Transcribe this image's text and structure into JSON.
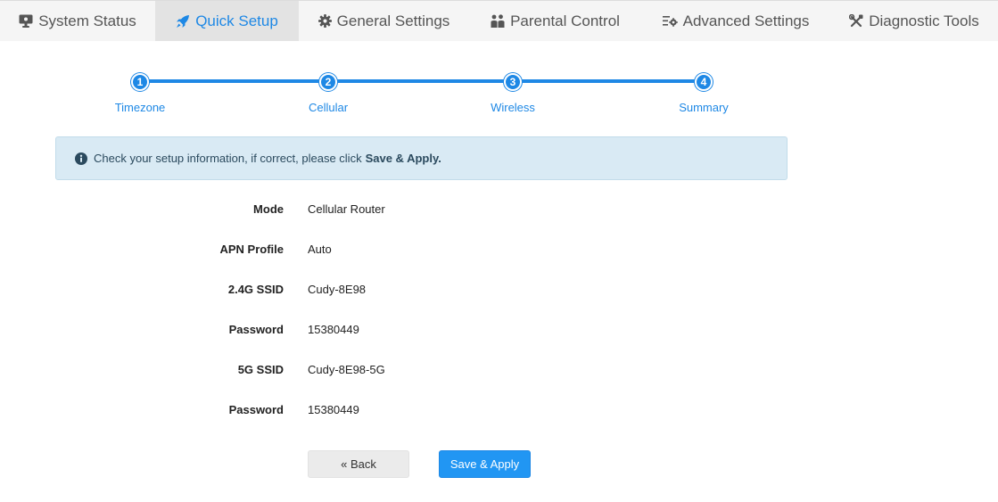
{
  "nav": {
    "tabs": [
      {
        "label": "System Status",
        "icon": "monitor-icon",
        "active": false
      },
      {
        "label": "Quick Setup",
        "icon": "rocket-icon",
        "active": true
      },
      {
        "label": "General Settings",
        "icon": "gear-icon",
        "active": false
      },
      {
        "label": "Parental Control",
        "icon": "family-icon",
        "active": false
      },
      {
        "label": "Advanced Settings",
        "icon": "list-gear-icon",
        "active": false
      },
      {
        "label": "Diagnostic Tools",
        "icon": "tools-icon",
        "active": false
      }
    ]
  },
  "stepper": {
    "steps": [
      {
        "number": "1",
        "label": "Timezone"
      },
      {
        "number": "2",
        "label": "Cellular"
      },
      {
        "number": "3",
        "label": "Wireless"
      },
      {
        "number": "4",
        "label": "Summary"
      }
    ],
    "current_step": 4
  },
  "alert": {
    "icon": "info-icon",
    "text": "Check your setup information, if correct, please click",
    "emphasis": "Save & Apply."
  },
  "summary": {
    "rows": [
      {
        "label": "Mode",
        "value": "Cellular Router"
      },
      {
        "label": "APN Profile",
        "value": "Auto"
      },
      {
        "label": "2.4G SSID",
        "value": "Cudy-8E98"
      },
      {
        "label": "Password",
        "value": "15380449"
      },
      {
        "label": "5G SSID",
        "value": "Cudy-8E98-5G"
      },
      {
        "label": "Password",
        "value": "15380449"
      }
    ]
  },
  "buttons": {
    "back_label": "« Back",
    "save_label": "Save & Apply"
  },
  "colors": {
    "accent": "#1e88e5",
    "save_button": "#2196f3",
    "alert_background": "#d9eaf4",
    "nav_background": "#f5f5f5",
    "nav_active_background": "#e3e3e3"
  }
}
